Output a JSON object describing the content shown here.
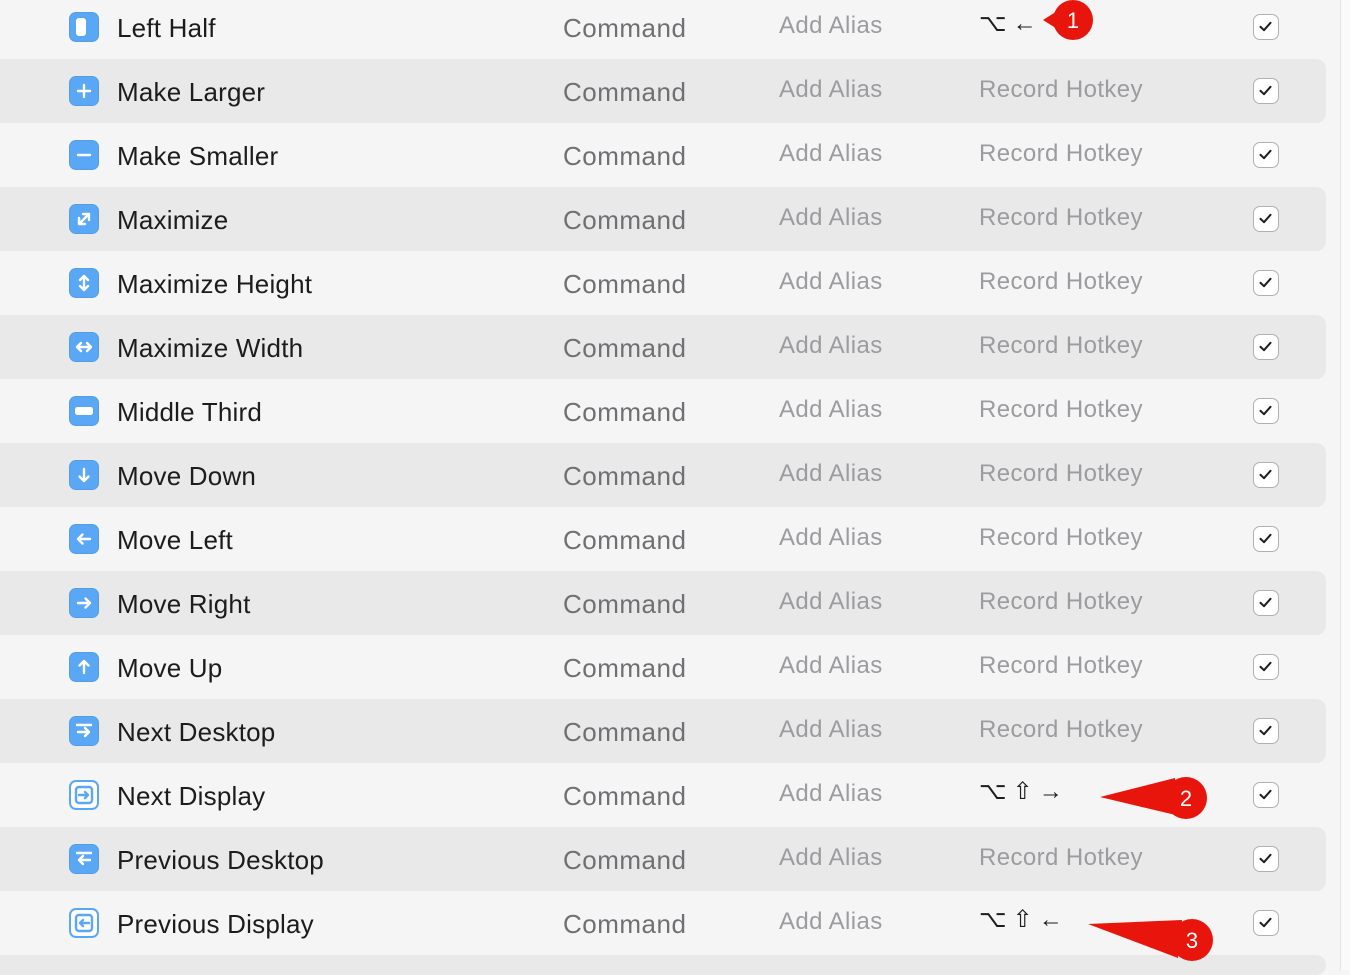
{
  "rows": [
    {
      "name": "Left Half",
      "type": "Command",
      "alias": "Add Alias",
      "hotkey": "⌥←",
      "hotkey_set": true,
      "enabled": true,
      "icon": "left-half-icon",
      "alt": false
    },
    {
      "name": "Make Larger",
      "type": "Command",
      "alias": "Add Alias",
      "hotkey": "Record Hotkey",
      "hotkey_set": false,
      "enabled": true,
      "icon": "plus-icon",
      "alt": true
    },
    {
      "name": "Make Smaller",
      "type": "Command",
      "alias": "Add Alias",
      "hotkey": "Record Hotkey",
      "hotkey_set": false,
      "enabled": true,
      "icon": "minus-icon",
      "alt": false
    },
    {
      "name": "Maximize",
      "type": "Command",
      "alias": "Add Alias",
      "hotkey": "Record Hotkey",
      "hotkey_set": false,
      "enabled": true,
      "icon": "expand-diagonal-icon",
      "alt": true
    },
    {
      "name": "Maximize Height",
      "type": "Command",
      "alias": "Add Alias",
      "hotkey": "Record Hotkey",
      "hotkey_set": false,
      "enabled": true,
      "icon": "vertical-arrows-icon",
      "alt": false
    },
    {
      "name": "Maximize Width",
      "type": "Command",
      "alias": "Add Alias",
      "hotkey": "Record Hotkey",
      "hotkey_set": false,
      "enabled": true,
      "icon": "horizontal-arrows-icon",
      "alt": true
    },
    {
      "name": "Middle Third",
      "type": "Command",
      "alias": "Add Alias",
      "hotkey": "Record Hotkey",
      "hotkey_set": false,
      "enabled": true,
      "icon": "middle-third-icon",
      "alt": false
    },
    {
      "name": "Move Down",
      "type": "Command",
      "alias": "Add Alias",
      "hotkey": "Record Hotkey",
      "hotkey_set": false,
      "enabled": true,
      "icon": "arrow-down-icon",
      "alt": true
    },
    {
      "name": "Move Left",
      "type": "Command",
      "alias": "Add Alias",
      "hotkey": "Record Hotkey",
      "hotkey_set": false,
      "enabled": true,
      "icon": "arrow-left-icon",
      "alt": false
    },
    {
      "name": "Move Right",
      "type": "Command",
      "alias": "Add Alias",
      "hotkey": "Record Hotkey",
      "hotkey_set": false,
      "enabled": true,
      "icon": "arrow-right-icon",
      "alt": true
    },
    {
      "name": "Move Up",
      "type": "Command",
      "alias": "Add Alias",
      "hotkey": "Record Hotkey",
      "hotkey_set": false,
      "enabled": true,
      "icon": "arrow-up-icon",
      "alt": false
    },
    {
      "name": "Next Desktop",
      "type": "Command",
      "alias": "Add Alias",
      "hotkey": "Record Hotkey",
      "hotkey_set": false,
      "enabled": true,
      "icon": "next-desktop-icon",
      "alt": true
    },
    {
      "name": "Next Display",
      "type": "Command",
      "alias": "Add Alias",
      "hotkey": "⌥⇧→",
      "hotkey_set": true,
      "enabled": true,
      "icon": "next-display-icon",
      "alt": false
    },
    {
      "name": "Previous Desktop",
      "type": "Command",
      "alias": "Add Alias",
      "hotkey": "Record Hotkey",
      "hotkey_set": false,
      "enabled": true,
      "icon": "previous-desktop-icon",
      "alt": true
    },
    {
      "name": "Previous Display",
      "type": "Command",
      "alias": "Add Alias",
      "hotkey": "⌥⇧←",
      "hotkey_set": true,
      "enabled": true,
      "icon": "previous-display-icon",
      "alt": false
    }
  ],
  "annotations": [
    {
      "label": "1",
      "color": "#e8150c"
    },
    {
      "label": "2",
      "color": "#e8150c"
    },
    {
      "label": "3",
      "color": "#e8150c"
    }
  ],
  "colors": {
    "icon_blue": "#5aa7f5",
    "row_alt": "#e9e9e9",
    "background": "#f5f5f5",
    "annotation_red": "#e8150c"
  }
}
